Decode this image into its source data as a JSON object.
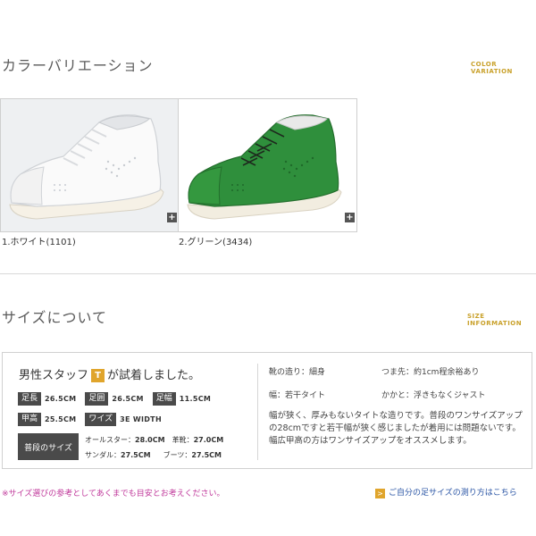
{
  "color_section": {
    "title": "カラーバリエーション",
    "title_en": "COLOR VARIATION",
    "products": [
      {
        "caption": "1.ホワイト(1101)",
        "color": "#f4f4f2",
        "sole": "#f7f3ea",
        "lace": "#e8e8e8",
        "bg": "#f1f2f4"
      },
      {
        "caption": "2.グリーン(3434)",
        "color": "#2f8f3c",
        "sole": "#f3efe3",
        "lace": "#1c2a1c",
        "bg": "#ffffff"
      }
    ],
    "plus_label": "+"
  },
  "size_section": {
    "title": "サイズについて",
    "title_en": "SIZE INFORMATION",
    "staff": {
      "prefix": "男性スタッフ",
      "badge": "T",
      "suffix": "が試着しました。"
    },
    "measures_row1": [
      {
        "label": "足長",
        "value": "26.5CM"
      },
      {
        "label": "足囲",
        "value": "26.5CM"
      },
      {
        "label": "足幅",
        "value": "11.5CM"
      }
    ],
    "measures_row2": [
      {
        "label": "甲高",
        "value": "25.5CM"
      },
      {
        "label": "ワイズ",
        "value": "3E WIDTH"
      }
    ],
    "usual_label": "普段のサイズ",
    "usual_sizes": [
      {
        "name": "オールスター：",
        "value": "28.0CM"
      },
      {
        "name": "革靴：",
        "value": "27.0CM"
      },
      {
        "name": "サンダル：",
        "value": "27.5CM"
      },
      {
        "name": "ブーツ：",
        "value": "27.5CM"
      }
    ],
    "right_info": [
      {
        "label": "靴の造り：細身",
        "value": "つま先：約1cm程余裕あり"
      },
      {
        "label": "幅：若干タイト",
        "value": "かかと：浮きもなくジャスト"
      }
    ],
    "comment": "幅が狭く、厚みもないタイトな造りです。普段のワンサイズアップの28cmですと若干幅が狭く感じましたが着用には問題ないです。幅広甲高の方はワンサイズアップをオススメします。"
  },
  "footer": {
    "note": "※サイズ選びの参考としてあくまでも目安とお考えください。",
    "link": "ご自分の足サイズの測り方はこちら",
    "link_arrow": ">"
  }
}
